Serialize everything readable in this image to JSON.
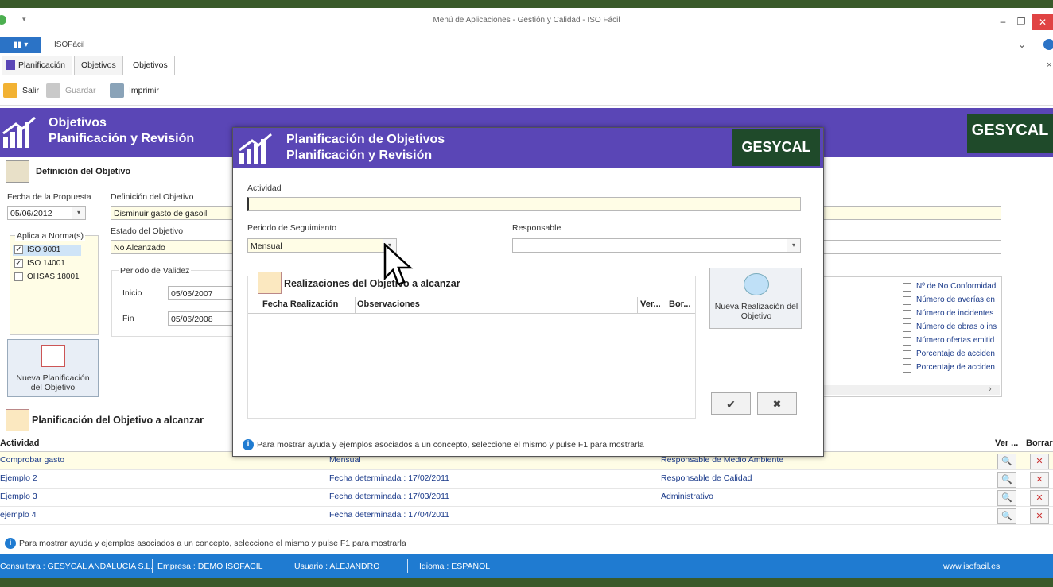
{
  "window": {
    "title": "Menú de Aplicaciones - Gestión y Calidad - ISO Fácil",
    "app_menu_label": "▮▮ ▾",
    "app_name": "ISOFácil"
  },
  "tabs": [
    {
      "label": "Planificación"
    },
    {
      "label": "Objetivos"
    },
    {
      "label": "Objetivos"
    }
  ],
  "toolbar": {
    "exit_label": "Salir",
    "save_label": "Guardar",
    "print_label": "Imprimir"
  },
  "header": {
    "title_line1": "Objetivos",
    "title_line2": "Planificación y Revisión",
    "logo_text": "GESYCAL"
  },
  "definition": {
    "section_title": "Definición del Objetivo",
    "proposal_date_label": "Fecha de la Propuesta",
    "proposal_date_value": "05/06/2012",
    "definition_label": "Definición del Objetivo",
    "definition_value": "Disminuir gasto de gasoil",
    "status_label": "Estado del Objetivo",
    "status_value": "No Alcanzado",
    "norms_label": "Aplica a Norma(s)",
    "norms": [
      {
        "label": "ISO 9001",
        "checked": true
      },
      {
        "label": "ISO 14001",
        "checked": true
      },
      {
        "label": "OHSAS 18001",
        "checked": false
      }
    ],
    "validity_label": "Periodo de Validez",
    "start_label": "Inicio",
    "start_value": "05/06/2007",
    "end_label": "Fin",
    "end_value": "05/06/2008",
    "new_plan_button": "Nueva Planificación del Objetivo",
    "indicators": [
      "Nº de No Conformidad",
      "Número de averías en",
      "Número de incidentes",
      "Número de obras o ins",
      "Número ofertas emitid",
      "Porcentaje de acciden",
      "Porcentaje de acciden"
    ]
  },
  "planning": {
    "section_title": "Planificación del Objetivo a alcanzar",
    "col_activity": "Actividad",
    "col_view": "Ver ...",
    "col_delete": "Borrar",
    "rows": [
      {
        "activity": "Comprobar gasto",
        "period": "Mensual",
        "responsible": "Responsable de Medio Ambiente"
      },
      {
        "activity": "Ejemplo 2",
        "period": "Fecha determinada : 17/02/2011",
        "responsible": "Responsable de Calidad"
      },
      {
        "activity": "Ejemplo 3",
        "period": "Fecha determinada : 17/03/2011",
        "responsible": "Administrativo"
      },
      {
        "activity": "ejemplo 4",
        "period": "Fecha determinada : 17/04/2011",
        "responsible": ""
      }
    ]
  },
  "help_text": "Para mostrar ayuda y ejemplos asociados a un concepto, seleccione el mismo y pulse F1 para mostrarla",
  "statusbar": {
    "consultora": "Consultora : GESYCAL ANDALUCIA S.L.",
    "empresa": "Empresa : DEMO ISOFACIL",
    "usuario": "Usuario : ALEJANDRO",
    "idioma": "Idioma : ESPAÑOL",
    "web": "www.isofacil.es"
  },
  "modal": {
    "title_line1": "Planificación de Objetivos",
    "title_line2": "Planificación y Revisión",
    "logo_text": "GESYCAL",
    "activity_label": "Actividad",
    "activity_value": "",
    "period_label": "Periodo de Seguimiento",
    "period_value": "Mensual",
    "responsible_label": "Responsable",
    "responsible_value": "",
    "realizations_title": "Realizaciones del Objetivo a alcanzar",
    "col_date": "Fecha Realización",
    "col_obs": "Observaciones",
    "col_view": "Ver...",
    "col_delete": "Bor...",
    "new_realization_button": "Nueva Realización del Objetivo",
    "help_text": "Para mostrar ayuda y ejemplos asociados a un concepto, seleccione el mismo y pulse F1 para mostrarla"
  },
  "colors": {
    "header_purple": "#5a46b6",
    "status_blue": "#1f7bd1",
    "field_yellow": "#fffde6",
    "logo_green": "#1f4a2a"
  }
}
